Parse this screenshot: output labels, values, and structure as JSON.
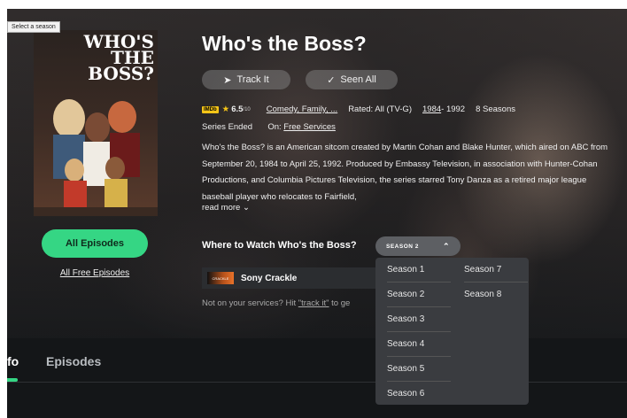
{
  "tooltip": "Select a season",
  "poster": {
    "title": "WHO'S THE BOSS?"
  },
  "show": {
    "title": "Who's the Boss?",
    "imdb_badge": "IMDb",
    "imdb_score": "6.5",
    "imdb_outof": "/10",
    "genres": "Comedy, Family, ...",
    "rated": "Rated: All (TV-G)",
    "year_start": "1984",
    "year_end": " - 1992",
    "seasons": "8 Seasons",
    "status": "Series Ended",
    "on_label": "On: ",
    "on_service": "Free Services",
    "description": "Who's the Boss? is an American sitcom created by Martin Cohan and Blake Hunter, which aired on ABC from September 20, 1984 to April 25, 1992. Produced by Embassy Television, in association with Hunter-Cohan Productions, and Columbia Pictures Television, the series starred Tony Danza as a retired major league baseball player who relocates to Fairfield,",
    "read_more": "read more"
  },
  "actions": {
    "track": "Track It",
    "seen": "Seen All"
  },
  "episodes": {
    "all": "All Episodes",
    "free": "All Free Episodes"
  },
  "where": {
    "heading": "Where to Watch Who's the Boss?",
    "selected_season": "SEASON 2",
    "service_logo": "CRACKLE",
    "service_name": "Sony Crackle",
    "not_on_prefix": "Not on your services? Hit ",
    "not_on_link": "\"track it\"",
    "not_on_suffix": " to ge"
  },
  "season_options": [
    "Season 1",
    "Season 2",
    "Season 3",
    "Season 4",
    "Season 5",
    "Season 6",
    "Season 7",
    "Season 8"
  ],
  "tabs": {
    "info": "fo",
    "episodes": "Episodes"
  },
  "colors": {
    "accent": "#35d684",
    "imdb": "#f5c518",
    "background": "#141618",
    "dropdown": "#3a3c40"
  }
}
